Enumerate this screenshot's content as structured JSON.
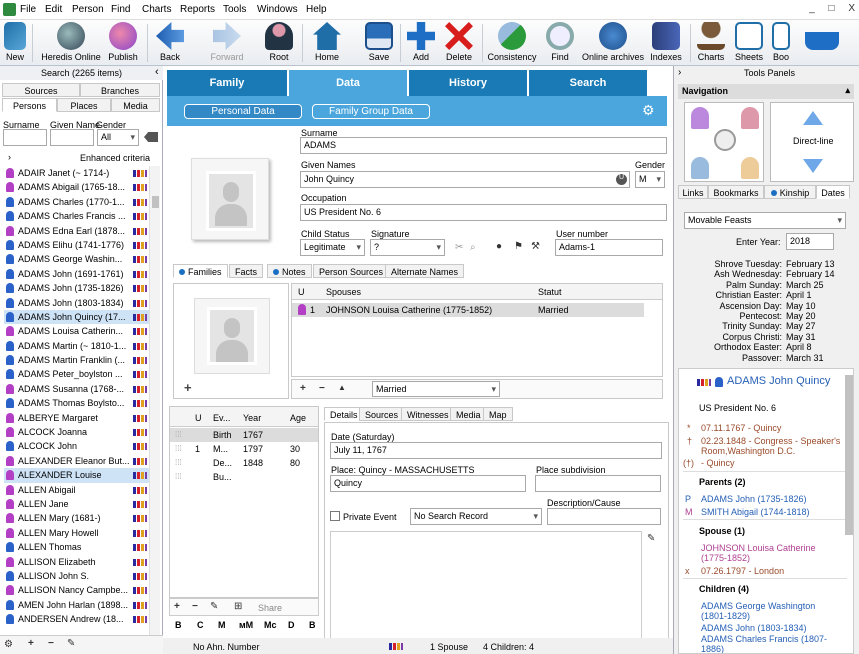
{
  "menubar": {
    "items": [
      "File",
      "Edit",
      "Person",
      "Find",
      "Charts",
      "Reports",
      "Tools",
      "Windows",
      "Help"
    ],
    "window_controls": [
      "_",
      "□",
      "X"
    ]
  },
  "toolbar": {
    "buttons": [
      {
        "label": "New",
        "icon": "new-icon",
        "enabled": true
      },
      {
        "label": "Heredis Online",
        "icon": "heredis-online-icon",
        "enabled": true
      },
      {
        "label": "Publish",
        "icon": "publish-icon",
        "enabled": true
      },
      {
        "label": "Back",
        "icon": "back-arrow-icon",
        "enabled": true
      },
      {
        "label": "Forward",
        "icon": "forward-arrow-icon",
        "enabled": false
      },
      {
        "label": "Root",
        "icon": "root-person-icon",
        "enabled": true
      },
      {
        "label": "Home",
        "icon": "home-icon",
        "enabled": true
      },
      {
        "label": "Save",
        "icon": "save-icon",
        "enabled": true
      },
      {
        "label": "Add",
        "icon": "add-icon",
        "enabled": true
      },
      {
        "label": "Delete",
        "icon": "delete-icon",
        "enabled": true
      },
      {
        "label": "Consistency",
        "icon": "consistency-icon",
        "enabled": true
      },
      {
        "label": "Find",
        "icon": "find-icon",
        "enabled": true
      },
      {
        "label": "Online archives",
        "icon": "online-archives-icon",
        "enabled": true
      },
      {
        "label": "Indexes",
        "icon": "indexes-icon",
        "enabled": true
      },
      {
        "label": "Charts",
        "icon": "charts-tree-icon",
        "enabled": true
      },
      {
        "label": "Sheets",
        "icon": "sheets-icon",
        "enabled": true
      },
      {
        "label": "Boo",
        "icon": "books-icon",
        "enabled": true
      },
      {
        "label": "",
        "icon": "basket-icon",
        "enabled": true
      }
    ]
  },
  "left": {
    "title": "Search (2265 items)",
    "collapse": "‹",
    "tabs_top": [
      "Sources",
      "Branches"
    ],
    "tabs_bottom": [
      "Persons",
      "Places",
      "Media"
    ],
    "filter_labels": {
      "surname": "Surname",
      "given": "Given Name",
      "gender": "Gender"
    },
    "gender_value": "All",
    "enhanced": "Enhanced criteria",
    "persons": [
      {
        "name": "ADAIR Janet (~ 1714-)",
        "g": "f"
      },
      {
        "name": "ADAMS Abigail (1765-18...",
        "g": "f"
      },
      {
        "name": "ADAMS Charles (1770-1...",
        "g": "m"
      },
      {
        "name": "ADAMS Charles Francis ...",
        "g": "m"
      },
      {
        "name": "ADAMS Edna Earl (1878...",
        "g": "f"
      },
      {
        "name": "ADAMS Elihu (1741-1776)",
        "g": "m"
      },
      {
        "name": "ADAMS George Washin...",
        "g": "m"
      },
      {
        "name": "ADAMS John (1691-1761)",
        "g": "m"
      },
      {
        "name": "ADAMS John (1735-1826)",
        "g": "m"
      },
      {
        "name": "ADAMS John (1803-1834)",
        "g": "m"
      },
      {
        "name": "ADAMS John Quincy (17...",
        "g": "m",
        "selected": true
      },
      {
        "name": "ADAMS Louisa Catherin...",
        "g": "f"
      },
      {
        "name": "ADAMS Martin (~ 1810-1...",
        "g": "m"
      },
      {
        "name": "ADAMS Martin Franklin (...",
        "g": "m"
      },
      {
        "name": "ADAMS Peter_boylston ...",
        "g": "m"
      },
      {
        "name": "ADAMS Susanna (1768-...",
        "g": "f"
      },
      {
        "name": "ADAMS Thomas Boylsto...",
        "g": "m"
      },
      {
        "name": "ALBERYE Margaret",
        "g": "f"
      },
      {
        "name": "ALCOCK Joanna",
        "g": "f"
      },
      {
        "name": "ALCOCK John",
        "g": "m"
      },
      {
        "name": "ALEXANDER Eleanor But...",
        "g": "f"
      },
      {
        "name": "ALEXANDER Louise",
        "g": "f",
        "selected": true
      },
      {
        "name": "ALLEN Abigail",
        "g": "f"
      },
      {
        "name": "ALLEN Jane",
        "g": "f"
      },
      {
        "name": "ALLEN Mary (1681-)",
        "g": "f"
      },
      {
        "name": "ALLEN Mary Howell",
        "g": "f"
      },
      {
        "name": "ALLEN Thomas",
        "g": "m"
      },
      {
        "name": "ALLISON Elizabeth",
        "g": "f"
      },
      {
        "name": "ALLISON John S.",
        "g": "m"
      },
      {
        "name": "ALLISON Nancy Campbe...",
        "g": "f"
      },
      {
        "name": "AMEN John Harlan (1898...",
        "g": "m"
      },
      {
        "name": "ANDERSEN Andrew (18...",
        "g": "m"
      }
    ]
  },
  "center": {
    "main_tabs": [
      "Family",
      "Data",
      "History",
      "Search"
    ],
    "sub_buttons": [
      "Personal Data",
      "Family Group Data"
    ],
    "surname_label": "Surname",
    "surname": "ADAMS",
    "given_label": "Given Names",
    "given": "John Quincy",
    "gender_label": "Gender",
    "gender": "M",
    "occupation_label": "Occupation",
    "occupation": "US President No. 6",
    "child_status_label": "Child Status",
    "child_status": "Legitimate",
    "signature_label": "Signature",
    "signature": "?",
    "user_number_label": "User number",
    "user_number": "Adams-1",
    "family_tabs": [
      "Families",
      "Facts",
      "Notes",
      "Person Sources",
      "Alternate Names"
    ],
    "spouse_hdr": {
      "u": "U",
      "spouses": "Spouses",
      "statut": "Statut"
    },
    "spouse_row": {
      "u": "1",
      "name": "JOHNSON Louisa Catherine (1775-1852)",
      "statut": "Married"
    },
    "union_status": "Married",
    "events_hdr": {
      "u": "U",
      "ev": "Ev...",
      "year": "Year",
      "age": "Age"
    },
    "events": [
      {
        "u": "",
        "ev": "Birth",
        "year": "1767",
        "age": ""
      },
      {
        "u": "1",
        "ev": "M...",
        "year": "1797",
        "age": "30"
      },
      {
        "u": "",
        "ev": "De...",
        "year": "1848",
        "age": "80"
      },
      {
        "u": "",
        "ev": "Bu...",
        "year": "",
        "age": ""
      }
    ],
    "event_tools": {
      "share": "Share"
    },
    "format_buttons": [
      "B",
      "C",
      "M",
      "мM",
      "Mc",
      "D",
      "B"
    ],
    "detail_tabs": [
      "Details",
      "Sources",
      "Witnesses",
      "Media",
      "Map"
    ],
    "date_label": "Date (Saturday)",
    "date": "July 11, 1767",
    "place_label": "Place: Quincy - MASSACHUSETTS",
    "place": "Quincy",
    "subdivision_label": "Place subdivision",
    "description_label": "Description/Cause",
    "private_label": "Private Event",
    "search_record": "No Search Record"
  },
  "status": {
    "ahn": "No Ahn. Number",
    "spouse": "1 Spouse",
    "children": "4 Children: 4"
  },
  "right": {
    "title": "Tools Panels",
    "nav": "Navigation",
    "direct_line": "Direct-line",
    "tabs": [
      "Links",
      "Bookmarks",
      "Kinship",
      "Dates"
    ],
    "feast_select": "Movable Feasts",
    "enter_year_label": "Enter Year:",
    "enter_year": "2018",
    "feasts": [
      {
        "k": "Shrove Tuesday:",
        "v": "February 13"
      },
      {
        "k": "Ash Wednesday:",
        "v": "February 14"
      },
      {
        "k": "Palm Sunday:",
        "v": "March 25"
      },
      {
        "k": "Christian Easter:",
        "v": "April 1"
      },
      {
        "k": "Ascension Day:",
        "v": "May 10"
      },
      {
        "k": "Pentecost:",
        "v": "May 20"
      },
      {
        "k": "Trinity Sunday:",
        "v": "May 27"
      },
      {
        "k": "Corpus Christi:",
        "v": "May 31"
      },
      {
        "k": "Orthodox Easter:",
        "v": "April 8"
      },
      {
        "k": "Passover:",
        "v": "March 31"
      }
    ],
    "info": {
      "name": "ADAMS John Quincy",
      "occupation": "US President No. 6",
      "birth": "07.11.1767 - Quincy",
      "death": "02.23.1848 - Congress - Speaker's",
      "death2": "Room,Washington D.C.",
      "burial": "- Quincy",
      "parents_title": "Parents (2)",
      "father": "ADAMS John (1735-1826)",
      "mother": "SMITH Abigail (1744-1818)",
      "spouse_title": "Spouse (1)",
      "spouse1": "JOHNSON Louisa Catherine",
      "spouse2": "(1775-1852)",
      "marriage": "07.26.1797 - London",
      "children_title": "Children (4)",
      "child1a": "ADAMS George Washington",
      "child1b": "(1801-1829)",
      "child2": "ADAMS John (1803-1834)",
      "child3a": "ADAMS Charles Francis (1807-",
      "child3b": "1886)"
    }
  }
}
